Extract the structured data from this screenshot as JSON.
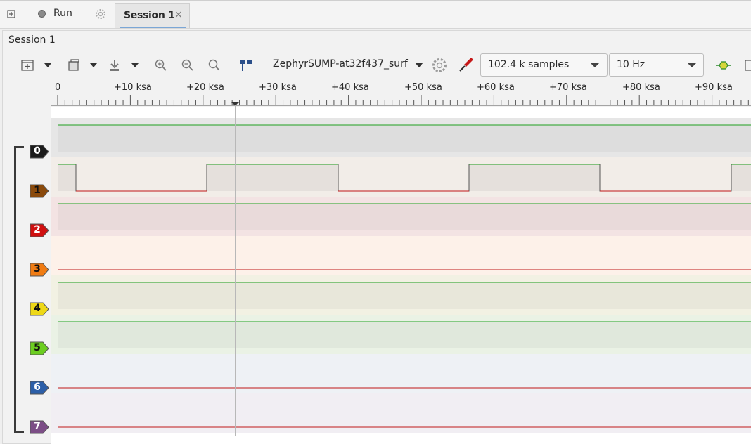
{
  "tabbar": {
    "run_label": "Run",
    "session_tab_label": "Session 1",
    "session_tab_close": "×"
  },
  "panel": {
    "title": "Session 1"
  },
  "toolbar": {
    "device": "ZephyrSUMP-at32f437_surf",
    "sample_count": "102.4 k samples",
    "sample_rate": "10 Hz"
  },
  "ruler": {
    "labels": [
      "0",
      "+10 ksa",
      "+20 ksa",
      "+30 ksa",
      "+40 ksa",
      "+50 ksa",
      "+60 ksa",
      "+70 ksa",
      "+80 ksa",
      "+90 ksa"
    ]
  },
  "channels": [
    {
      "number": "0",
      "color": "#1b1b1b",
      "lane_color": "#e6e6e6",
      "state": "high"
    },
    {
      "number": "1",
      "color": "#8a4a0c",
      "lane_color": "#f2ede8",
      "state": "clock"
    },
    {
      "number": "2",
      "color": "#d01010",
      "lane_color": "#f3e3e3",
      "state": "high"
    },
    {
      "number": "3",
      "color": "#f07c14",
      "lane_color": "#fdf1e9",
      "state": "low"
    },
    {
      "number": "4",
      "color": "#eed818",
      "lane_color": "#f2f1e3",
      "state": "high"
    },
    {
      "number": "5",
      "color": "#6ccd20",
      "lane_color": "#eaf2e5",
      "state": "high"
    },
    {
      "number": "6",
      "color": "#2c5fa8",
      "lane_color": "#eef1f5",
      "state": "low"
    },
    {
      "number": "7",
      "color": "#7c4e86",
      "lane_color": "#f1eef3",
      "state": "low"
    }
  ],
  "colors": {
    "high_line": "#1ea01e",
    "low_line": "#c01818",
    "cursor": "#b8b8b8"
  }
}
